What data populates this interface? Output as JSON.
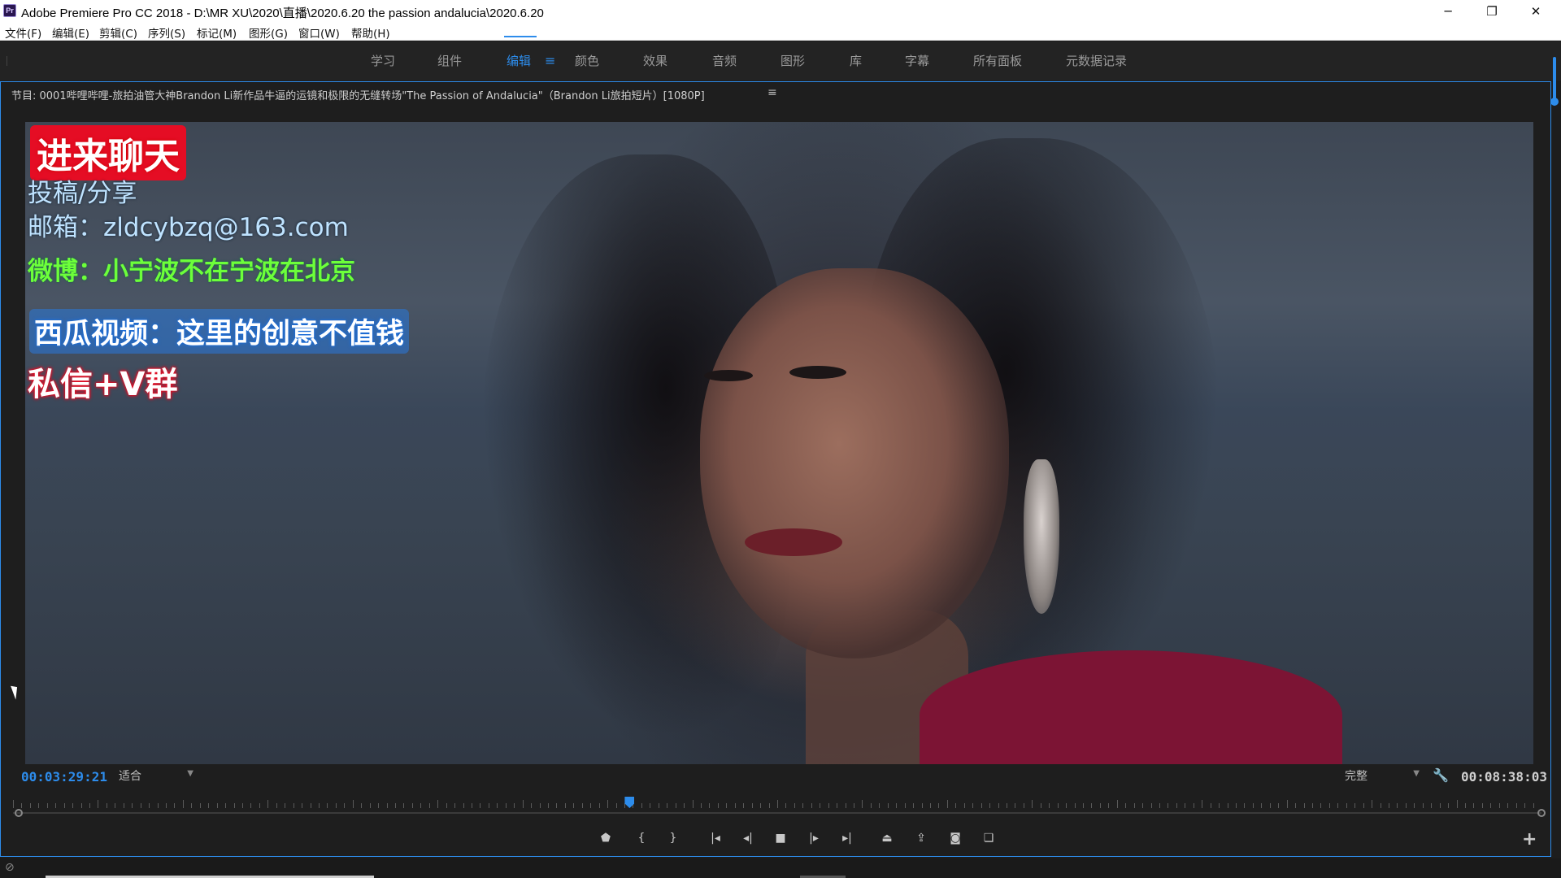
{
  "app": {
    "title": "Adobe Premiere Pro CC 2018 - D:\\MR XU\\2020\\直播\\2020.6.20 the passion andalucia\\2020.6.20",
    "icon_label": "Pr"
  },
  "window_controls": {
    "minimize": "─",
    "restore": "❐",
    "close": "✕"
  },
  "menu": [
    "文件(F)",
    "编辑(E)",
    "剪辑(C)",
    "序列(S)",
    "标记(M)",
    "图形(G)",
    "窗口(W)",
    "帮助(H)"
  ],
  "workspaces": {
    "tabs": [
      "学习",
      "组件",
      "编辑",
      "颜色",
      "效果",
      "音频",
      "图形",
      "库",
      "字幕",
      "所有面板",
      "元数据记录"
    ],
    "active": "编辑"
  },
  "panel": {
    "title": "节目: 0001哔哩哔哩-旅拍油管大神Brandon Li新作品牛逼的运镜和极限的无缝转场\"The Passion of Andalucia\"（Brandon Li旅拍短片）[1080P]"
  },
  "overlay": {
    "chat": "进来聊天",
    "submit": "投稿/分享",
    "email": "邮箱：zldcybzq@163.com",
    "weibo": "微博：小宁波不在宁波在北京",
    "xigua": "西瓜视频：这里的创意不值钱",
    "pm": "私信+V群"
  },
  "controls": {
    "current_time": "00:03:29:21",
    "fit": "适合",
    "quality": "完整",
    "duration": "00:08:38:03",
    "playhead_fraction": 0.4034
  },
  "icons": {
    "marker": "marker-icon",
    "mark_in": "mark-in-icon",
    "mark_out": "mark-out-icon",
    "go_to_in": "go-to-in-icon",
    "step_back": "step-back-icon",
    "stop": "stop-icon",
    "step_forward": "step-forward-icon",
    "go_to_out": "go-to-out-icon",
    "lift": "lift-icon",
    "extract": "extract-icon",
    "export_frame": "camera-icon",
    "compare": "compare-view-icon",
    "add": "plus-icon"
  },
  "colors": {
    "accent": "#2d8ceb",
    "chat_bg": "#e50d24",
    "weibo_text": "#6dff3a"
  }
}
